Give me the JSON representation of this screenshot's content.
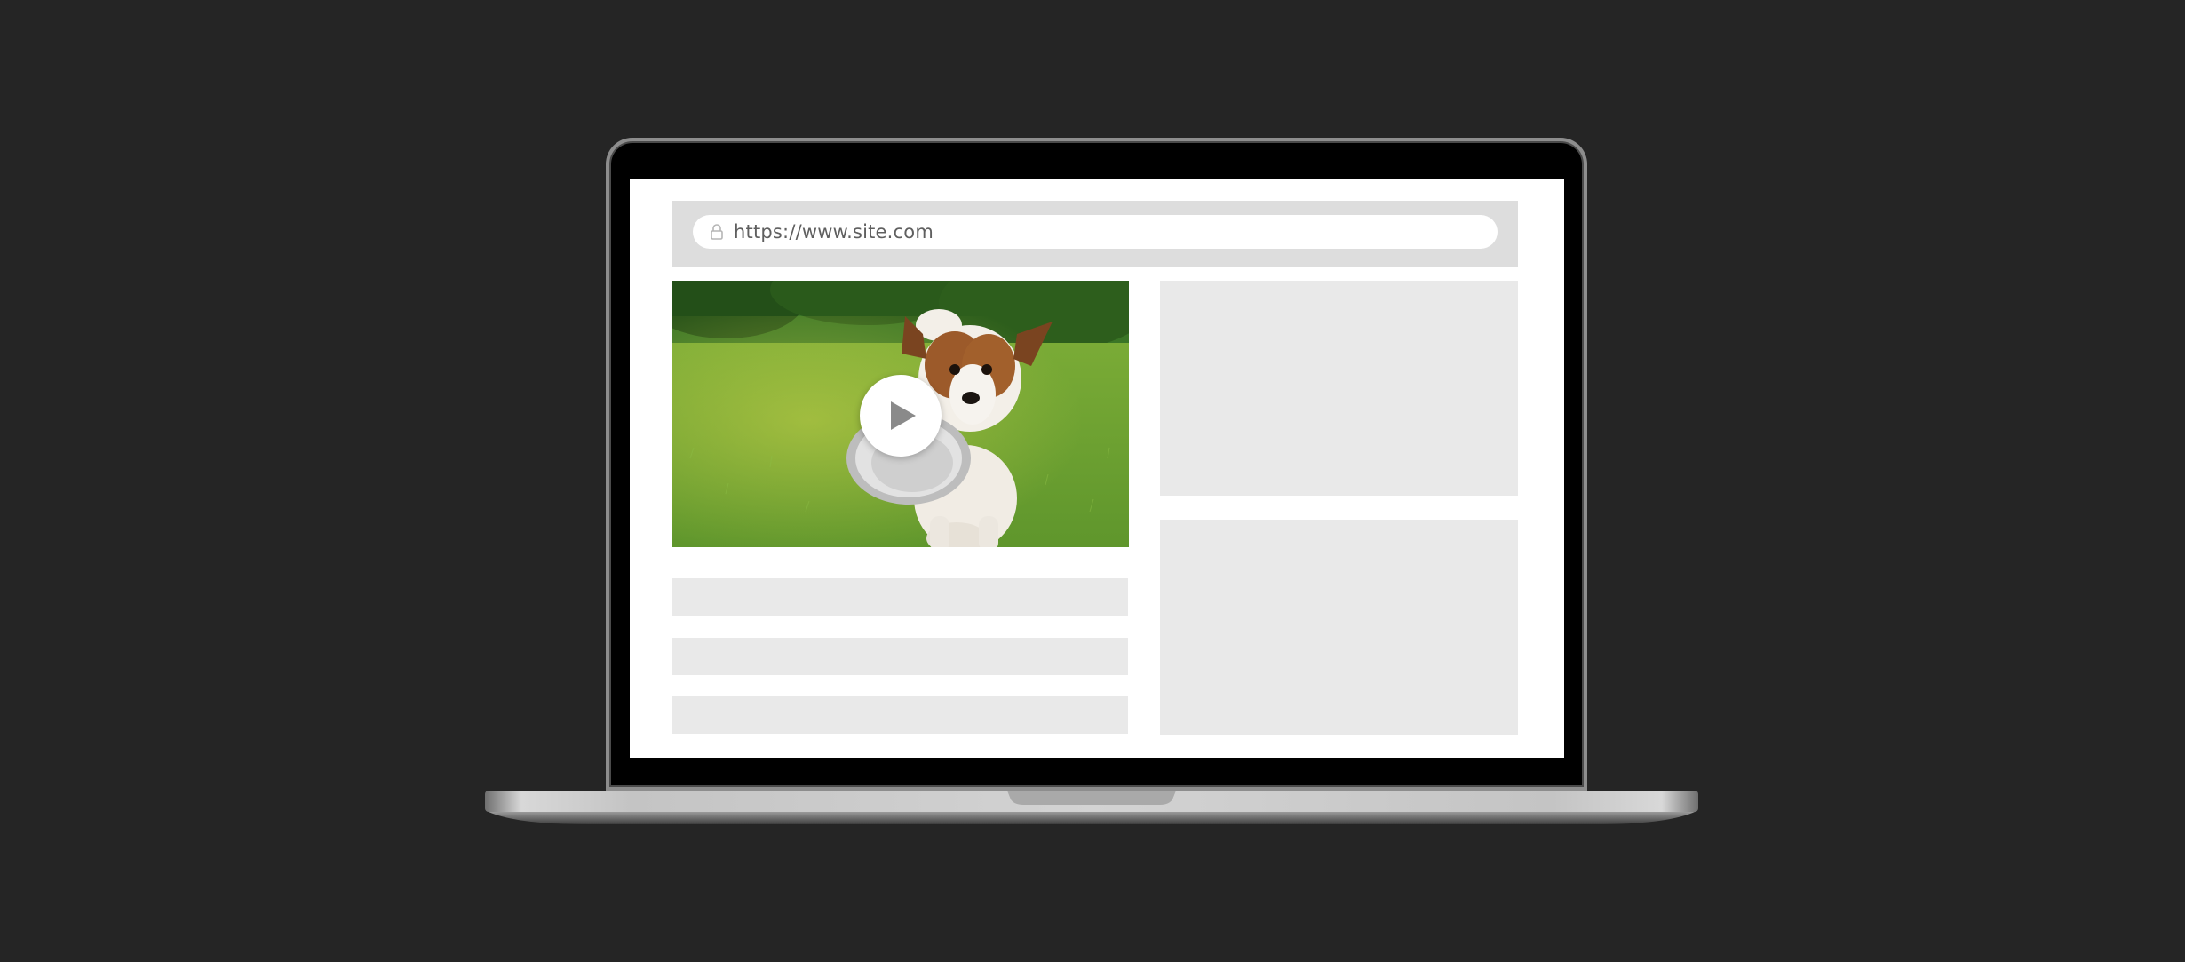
{
  "browser": {
    "url": "https://www.site.com",
    "lock_icon": "lock-icon"
  },
  "video": {
    "thumbnail": "dog-carrying-bowl-on-grass",
    "play_icon": "play-icon"
  },
  "colors": {
    "background": "#252525",
    "screen": "#ffffff",
    "address_bar": "#dddddd",
    "placeholder": "#e9e9e9",
    "url_text": "#5f5f5f"
  }
}
